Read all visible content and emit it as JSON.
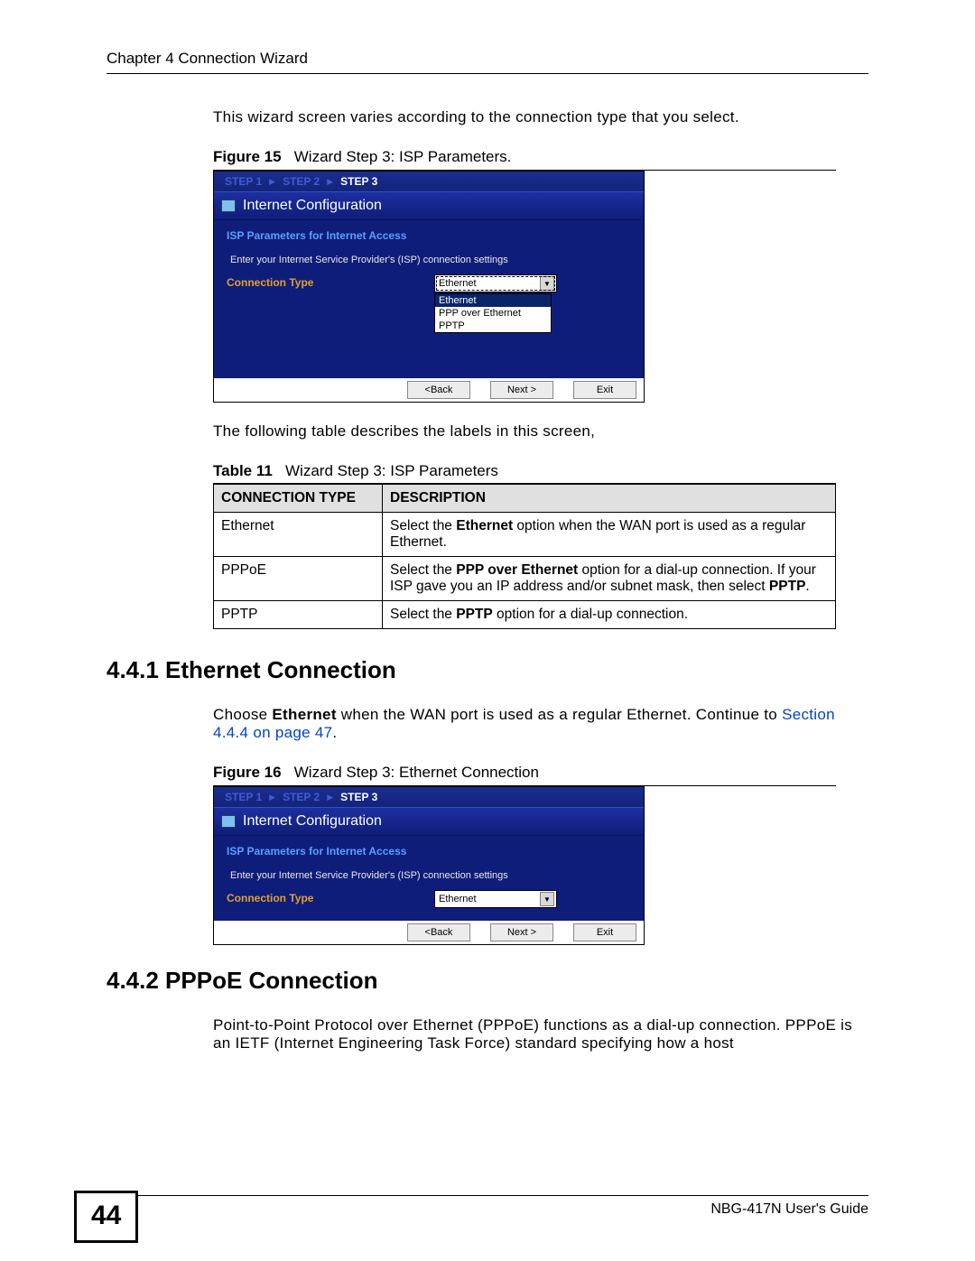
{
  "header": "Chapter 4 Connection Wizard",
  "intro": "This wizard screen varies according to the connection type that you select.",
  "fig15": {
    "label": "Figure 15",
    "title": "Wizard Step 3: ISP Parameters."
  },
  "wizard": {
    "step1": "STEP 1",
    "step2": "STEP 2",
    "step3": "STEP 3",
    "title": "Internet Configuration",
    "sec": "ISP Parameters for Internet Access",
    "instr": "Enter your Internet Service Provider's (ISP) connection settings",
    "conn_label": "Connection Type",
    "selected": "Ethernet",
    "options": [
      "Ethernet",
      "PPP over Ethernet",
      "PPTP"
    ],
    "back": "<Back",
    "next": "Next >",
    "exit": "Exit"
  },
  "mid_text": "The following table describes the labels in this screen,",
  "table11": {
    "label": "Table 11",
    "title": "Wizard Step 3: ISP Parameters",
    "h1": "CONNECTION TYPE",
    "h2": "DESCRIPTION",
    "r1c1": "Ethernet",
    "r1c2a": "Select the ",
    "r1c2b": "Ethernet",
    "r1c2c": " option when the WAN port is used as a regular Ethernet.",
    "r2c1": "PPPoE",
    "r2c2a": "Select the ",
    "r2c2b": "PPP over Ethernet",
    "r2c2c": " option for a dial-up connection. If your ISP gave you an IP address and/or subnet mask, then select ",
    "r2c2d": "PPTP",
    "r2c2e": ".",
    "r3c1": "PPTP",
    "r3c2a": "Select the ",
    "r3c2b": "PPTP",
    "r3c2c": " option for a dial-up connection."
  },
  "sec441": "4.4.1  Ethernet Connection",
  "eth_p1a": "Choose ",
  "eth_p1b": "Ethernet",
  "eth_p1c": " when the WAN port is used as a regular Ethernet. Continue to ",
  "eth_link": "Section 4.4.4 on page 47",
  "eth_p1d": ".",
  "fig16": {
    "label": "Figure 16",
    "title": "Wizard Step 3: Ethernet Connection"
  },
  "sec442": "4.4.2  PPPoE Connection",
  "pppoe_p": "Point-to-Point Protocol over Ethernet (PPPoE) functions as a dial-up connection. PPPoE is an IETF (Internet Engineering Task Force) standard specifying how a host",
  "pagenum": "44",
  "guide": "NBG-417N User's Guide"
}
